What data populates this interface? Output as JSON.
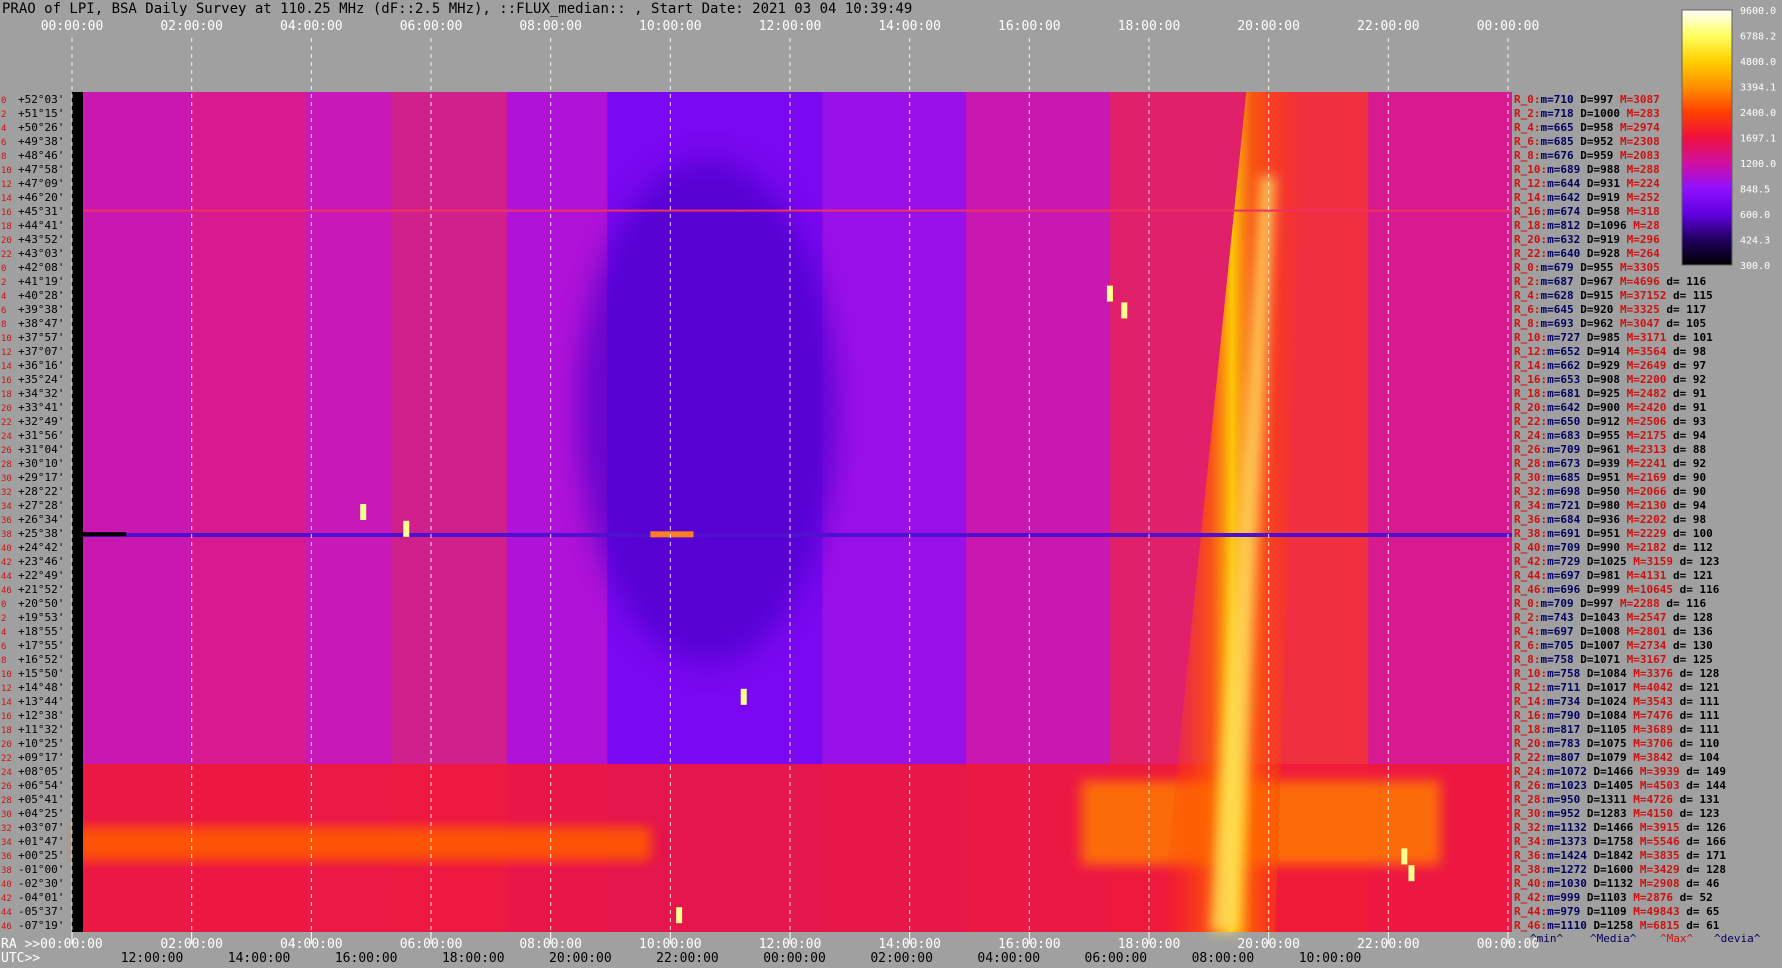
{
  "title": "PRAO of LPI, BSA Daily Survey at 110.25 MHz (dF::2.5 MHz), ::FLUX_median:: , Start Date: 2021 03 04 10:39:49",
  "chart_data": {
    "type": "heatmap",
    "top_time_labels": [
      "00:00:00",
      "02:00:00",
      "04:00:00",
      "06:00:00",
      "08:00:00",
      "10:00:00",
      "12:00:00",
      "14:00:00",
      "16:00:00",
      "18:00:00",
      "20:00:00",
      "22:00:00",
      "00:00:00"
    ],
    "bottom_ra_labels": [
      "RA >>00:00:00",
      "02:00:00",
      "04:00:00",
      "06:00:00",
      "08:00:00",
      "10:00:00",
      "12:00:00",
      "14:00:00",
      "16:00:00",
      "18:00:00",
      "20:00:00",
      "22:00:00",
      "00:00:00"
    ],
    "bottom_utc_labels": [
      "UTC>>",
      "12:00:00",
      "14:00:00",
      "16:00:00",
      "18:00:00",
      "20:00:00",
      "22:00:00",
      "00:00:00",
      "02:00:00",
      "04:00:00",
      "06:00:00",
      "08:00:00",
      "10:00:00"
    ],
    "colorbar_ticks": [
      "9600.0",
      "6788.2",
      "4800.0",
      "3394.1",
      "2400.0",
      "1697.1",
      "1200.0",
      "848.5",
      "600.0",
      "424.3",
      "300.0"
    ],
    "colorbar_colors": [
      "#ffffff",
      "#ffff60",
      "#ffd000",
      "#ff9000",
      "#ff4000",
      "#f01040",
      "#d010a0",
      "#9010ff",
      "#6000e0",
      "#200060",
      "#000000"
    ],
    "footer_keys": [
      "^min^",
      "^Media^",
      "^Max^",
      "^devia^"
    ],
    "declinations": [
      "+52°03'",
      "+51°15'",
      "+50°26'",
      "+49°38'",
      "+48°46'",
      "+47°58'",
      "+47°09'",
      "+46°20'",
      "+45°31'",
      "+44°41'",
      "+43°52'",
      "+43°03'",
      "+42°08'",
      "+41°19'",
      "+40°28'",
      "+39°38'",
      "+38°47'",
      "+37°57'",
      "+37°07'",
      "+36°16'",
      "+35°24'",
      "+34°32'",
      "+33°41'",
      "+32°49'",
      "+31°56'",
      "+31°04'",
      "+30°10'",
      "+29°17'",
      "+28°22'",
      "+27°28'",
      "+26°34'",
      "+25°38'",
      "+24°42'",
      "+23°46'",
      "+22°49'",
      "+21°52'",
      "+20°50'",
      "+19°53'",
      "+18°55'",
      "+17°55'",
      "+16°52'",
      "+15°50'",
      "+14°48'",
      "+13°44'",
      "+12°38'",
      "+11°32'",
      "+10°25'",
      "+09°17'",
      "+08°05'",
      "+06°54'",
      "+05°41'",
      "+04°25'",
      "+03°07'",
      "+01°47'",
      "+00°25'",
      "-01°00'",
      "-02°30'",
      "-04°01'",
      "-05°37'",
      "-07°19'"
    ],
    "row_numbers": [
      "0",
      "2",
      "4",
      "6",
      "8",
      "10",
      "12",
      "14",
      "16",
      "18",
      "20",
      "22",
      "0",
      "2",
      "4",
      "6",
      "8",
      "10",
      "12",
      "14",
      "16",
      "18",
      "20",
      "22",
      "24",
      "26",
      "28",
      "30",
      "32",
      "34",
      "36",
      "38",
      "40",
      "42",
      "44",
      "46",
      "0",
      "2",
      "4",
      "6",
      "8",
      "10",
      "12",
      "14",
      "16",
      "18",
      "20",
      "22",
      "24",
      "26",
      "28",
      "30",
      "32",
      "34",
      "36",
      "38",
      "40",
      "42",
      "44",
      "46"
    ],
    "stats": [
      {
        "r": "R_0:",
        "m": "710",
        "d": "997",
        "M": "3087",
        "dv": ""
      },
      {
        "r": "R_2:",
        "m": "718",
        "d": "1000",
        "M": "283",
        "dv": ""
      },
      {
        "r": "R_4:",
        "m": "665",
        "d": "958",
        "M": "2974",
        "dv": ""
      },
      {
        "r": "R_6:",
        "m": "685",
        "d": "952",
        "M": "2308",
        "dv": ""
      },
      {
        "r": "R_8:",
        "m": "676",
        "d": "959",
        "M": "2083",
        "dv": ""
      },
      {
        "r": "R_10:",
        "m": "689",
        "d": "988",
        "M": "288",
        "dv": ""
      },
      {
        "r": "R_12:",
        "m": "644",
        "d": "931",
        "M": "224",
        "dv": ""
      },
      {
        "r": "R_14:",
        "m": "642",
        "d": "919",
        "M": "252",
        "dv": ""
      },
      {
        "r": "R_16:",
        "m": "674",
        "d": "958",
        "M": "318",
        "dv": ""
      },
      {
        "r": "R_18:",
        "m": "812",
        "d": "1096",
        "M": "28",
        "dv": ""
      },
      {
        "r": "R_20:",
        "m": "632",
        "d": "919",
        "M": "296",
        "dv": ""
      },
      {
        "r": "R_22:",
        "m": "640",
        "d": "928",
        "M": "264",
        "dv": ""
      },
      {
        "r": "R_0:",
        "m": "679",
        "d": "955",
        "M": "3305",
        "dv": ""
      },
      {
        "r": "R_2:",
        "m": "687",
        "d": "967",
        "M": "4696",
        "dv": "116"
      },
      {
        "r": "R_4:",
        "m": "628",
        "d": "915",
        "M": "37152",
        "dv": "115"
      },
      {
        "r": "R_6:",
        "m": "645",
        "d": "920",
        "M": "3325",
        "dv": "117"
      },
      {
        "r": "R_8:",
        "m": "693",
        "d": "962",
        "M": "3047",
        "dv": "105"
      },
      {
        "r": "R_10:",
        "m": "727",
        "d": "985",
        "M": "3171",
        "dv": "101"
      },
      {
        "r": "R_12:",
        "m": "652",
        "d": "914",
        "M": "3564",
        "dv": "98"
      },
      {
        "r": "R_14:",
        "m": "662",
        "d": "929",
        "M": "2649",
        "dv": "97"
      },
      {
        "r": "R_16:",
        "m": "653",
        "d": "908",
        "M": "2200",
        "dv": "92"
      },
      {
        "r": "R_18:",
        "m": "681",
        "d": "925",
        "M": "2482",
        "dv": "91"
      },
      {
        "r": "R_20:",
        "m": "642",
        "d": "900",
        "M": "2420",
        "dv": "91"
      },
      {
        "r": "R_22:",
        "m": "650",
        "d": "912",
        "M": "2506",
        "dv": "93"
      },
      {
        "r": "R_24:",
        "m": "683",
        "d": "955",
        "M": "2175",
        "dv": "94"
      },
      {
        "r": "R_26:",
        "m": "709",
        "d": "961",
        "M": "2313",
        "dv": "88"
      },
      {
        "r": "R_28:",
        "m": "673",
        "d": "939",
        "M": "2241",
        "dv": "92"
      },
      {
        "r": "R_30:",
        "m": "685",
        "d": "951",
        "M": "2169",
        "dv": "90"
      },
      {
        "r": "R_32:",
        "m": "698",
        "d": "950",
        "M": "2066",
        "dv": "90"
      },
      {
        "r": "R_34:",
        "m": "721",
        "d": "980",
        "M": "2130",
        "dv": "94"
      },
      {
        "r": "R_36:",
        "m": "684",
        "d": "936",
        "M": "2202",
        "dv": "98"
      },
      {
        "r": "R_38:",
        "m": "691",
        "d": "951",
        "M": "2229",
        "dv": "100"
      },
      {
        "r": "R_40:",
        "m": "709",
        "d": "990",
        "M": "2182",
        "dv": "112"
      },
      {
        "r": "R_42:",
        "m": "729",
        "d": "1025",
        "M": "3159",
        "dv": "123"
      },
      {
        "r": "R_44:",
        "m": "697",
        "d": "981",
        "M": "4131",
        "dv": "121"
      },
      {
        "r": "R_46:",
        "m": "696",
        "d": "999",
        "M": "10645",
        "dv": "116"
      },
      {
        "r": "R_0:",
        "m": "709",
        "d": "997",
        "M": "2288",
        "dv": "116"
      },
      {
        "r": "R_2:",
        "m": "743",
        "d": "1043",
        "M": "2547",
        "dv": "128"
      },
      {
        "r": "R_4:",
        "m": "697",
        "d": "1008",
        "M": "2801",
        "dv": "136"
      },
      {
        "r": "R_6:",
        "m": "705",
        "d": "1007",
        "M": "2734",
        "dv": "130"
      },
      {
        "r": "R_8:",
        "m": "758",
        "d": "1071",
        "M": "3167",
        "dv": "125"
      },
      {
        "r": "R_10:",
        "m": "758",
        "d": "1084",
        "M": "3376",
        "dv": "128"
      },
      {
        "r": "R_12:",
        "m": "711",
        "d": "1017",
        "M": "4042",
        "dv": "121"
      },
      {
        "r": "R_14:",
        "m": "734",
        "d": "1024",
        "M": "3543",
        "dv": "111"
      },
      {
        "r": "R_16:",
        "m": "790",
        "d": "1084",
        "M": "7476",
        "dv": "111"
      },
      {
        "r": "R_18:",
        "m": "817",
        "d": "1105",
        "M": "3689",
        "dv": "111"
      },
      {
        "r": "R_20:",
        "m": "783",
        "d": "1075",
        "M": "3706",
        "dv": "110"
      },
      {
        "r": "R_22:",
        "m": "807",
        "d": "1079",
        "M": "3842",
        "dv": "104"
      },
      {
        "r": "R_24:",
        "m": "1072",
        "d": "1466",
        "M": "3939",
        "dv": "149"
      },
      {
        "r": "R_26:",
        "m": "1023",
        "d": "1405",
        "M": "4503",
        "dv": "144"
      },
      {
        "r": "R_28:",
        "m": "950",
        "d": "1311",
        "M": "4726",
        "dv": "131"
      },
      {
        "r": "R_30:",
        "m": "952",
        "d": "1283",
        "M": "4150",
        "dv": "123"
      },
      {
        "r": "R_32:",
        "m": "1132",
        "d": "1466",
        "M": "3915",
        "dv": "126"
      },
      {
        "r": "R_34:",
        "m": "1373",
        "d": "1758",
        "M": "5546",
        "dv": "166"
      },
      {
        "r": "R_36:",
        "m": "1424",
        "d": "1842",
        "M": "3835",
        "dv": "171"
      },
      {
        "r": "R_38:",
        "m": "1272",
        "d": "1600",
        "M": "3429",
        "dv": "128"
      },
      {
        "r": "R_40:",
        "m": "1030",
        "d": "1132",
        "M": "2908",
        "dv": "46"
      },
      {
        "r": "R_42:",
        "m": "999",
        "d": "1103",
        "M": "2876",
        "dv": "52"
      },
      {
        "r": "R_44:",
        "m": "979",
        "d": "1109",
        "M": "49843",
        "dv": "65"
      },
      {
        "r": "R_46:",
        "m": "1110",
        "d": "1258",
        "M": "6815",
        "dv": "61"
      }
    ]
  }
}
